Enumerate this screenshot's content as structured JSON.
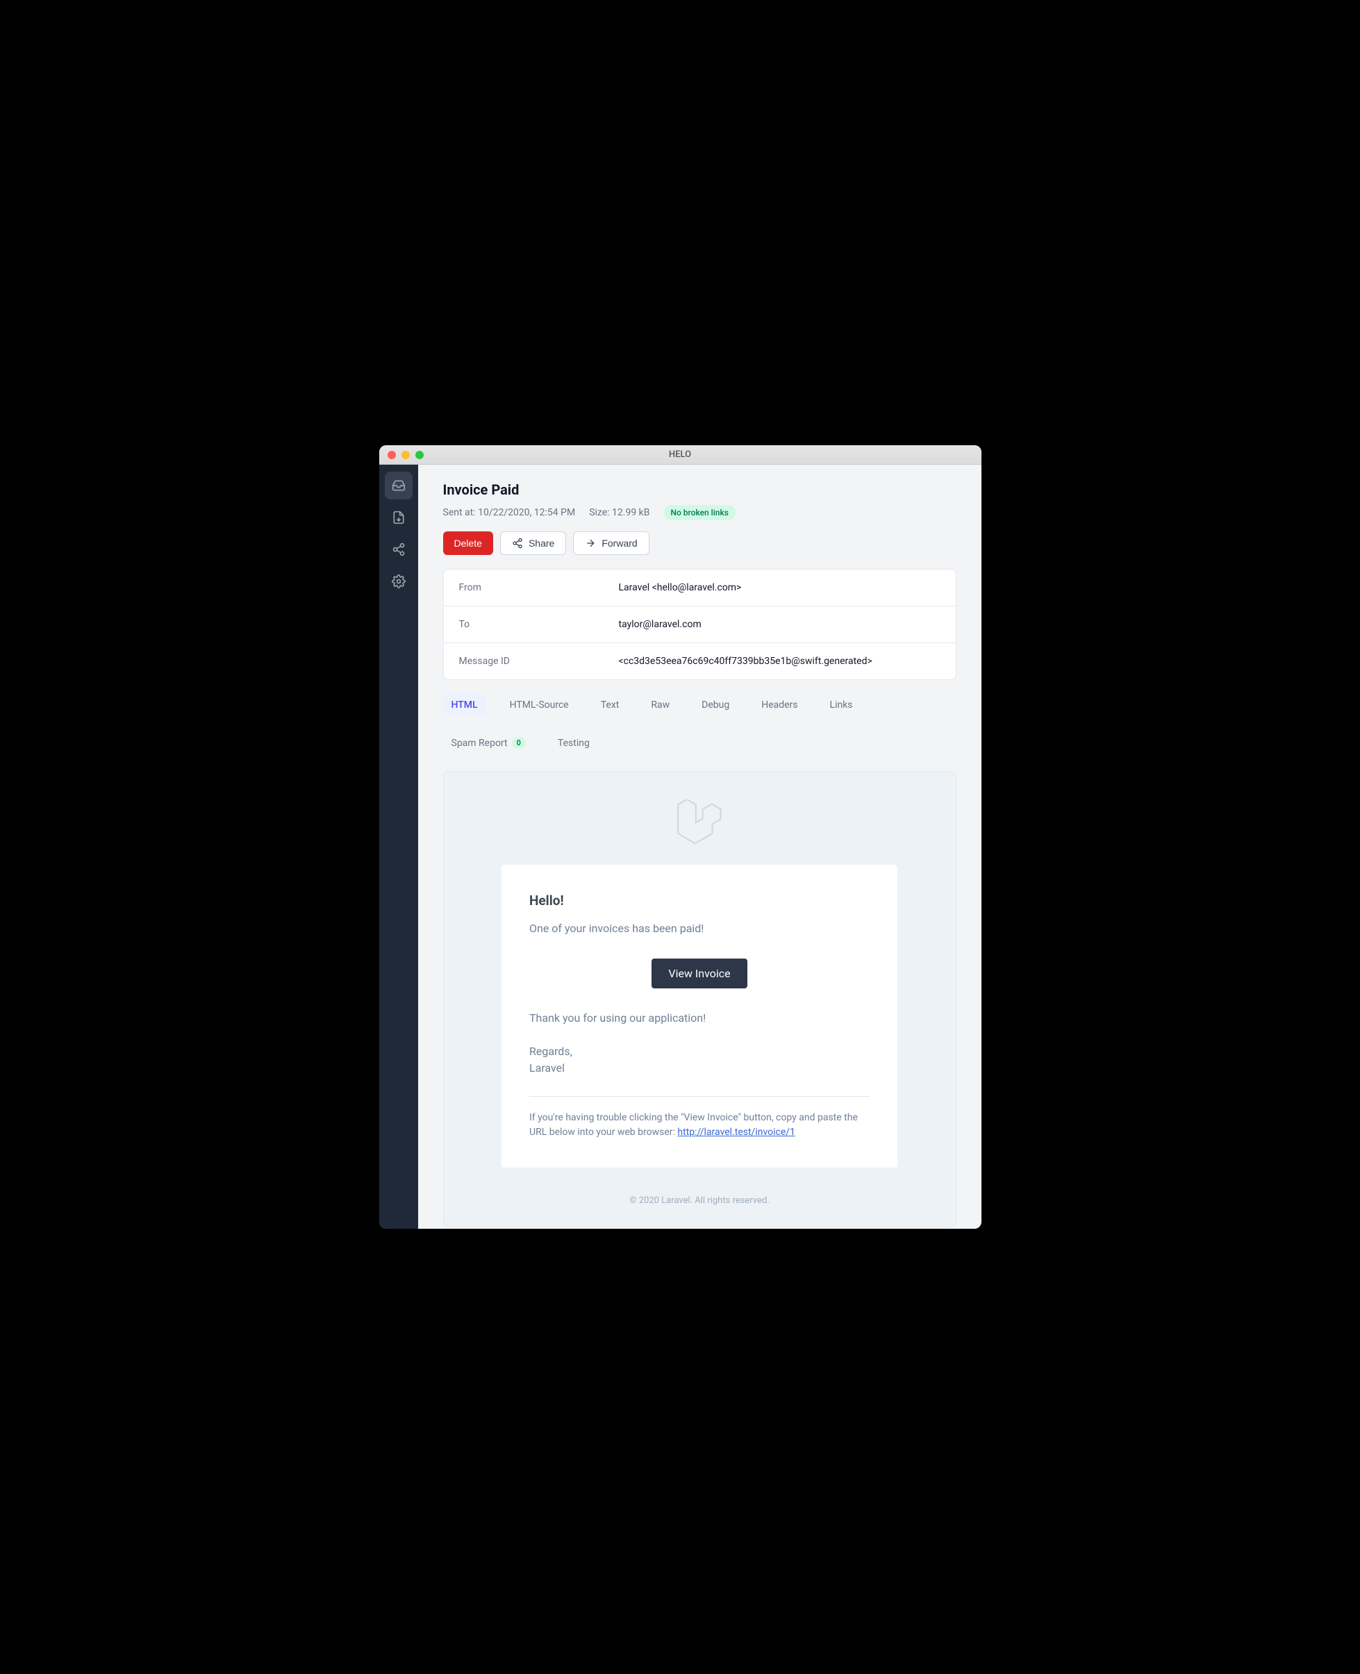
{
  "window": {
    "title": "HELO"
  },
  "page": {
    "title": "Invoice Paid"
  },
  "meta": {
    "sent_at_label": "Sent at: 10/22/2020, 12:54 PM",
    "size_label": "Size: 12.99 kB",
    "link_status": "No broken links"
  },
  "actions": {
    "delete": "Delete",
    "share": "Share",
    "forward": "Forward"
  },
  "details": {
    "from_label": "From",
    "from_value": "Laravel <hello@laravel.com>",
    "to_label": "To",
    "to_value": "taylor@laravel.com",
    "msgid_label": "Message ID",
    "msgid_value": "<cc3d3e53eea76c69c40ff7339bb35e1b@swift.generated>"
  },
  "tabs": {
    "html": "HTML",
    "html_source": "HTML-Source",
    "text": "Text",
    "raw": "Raw",
    "debug": "Debug",
    "headers": "Headers",
    "links": "Links",
    "spam_report": "Spam Report",
    "spam_count": "0",
    "testing": "Testing"
  },
  "email": {
    "greeting": "Hello!",
    "intro": "One of your invoices has been paid!",
    "button": "View Invoice",
    "outro": "Thank you for using our application!",
    "regards": "Regards,",
    "sender": "Laravel",
    "trouble_pre": "If you're having trouble clicking the \"View Invoice\" button, copy and paste the URL below into your web browser: ",
    "trouble_link": "http://laravel.test/invoice/1",
    "footer": "© 2020 Laravel. All rights reserved."
  }
}
